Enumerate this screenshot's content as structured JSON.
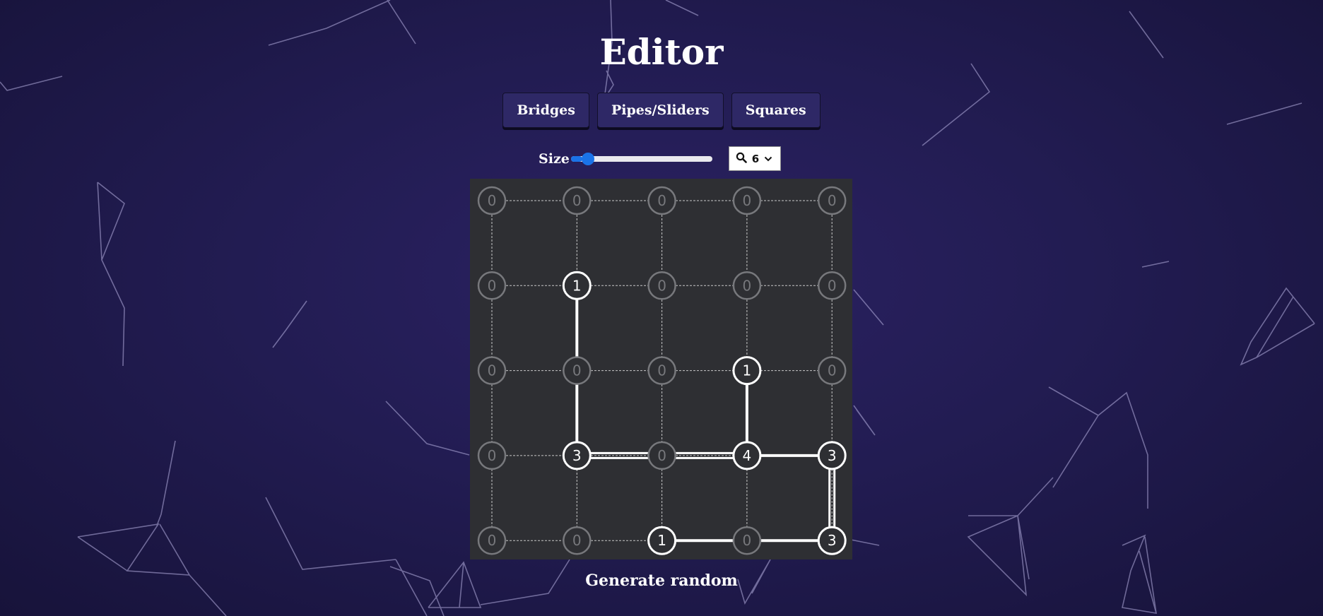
{
  "page": {
    "title": "Editor"
  },
  "modes": [
    {
      "label": "Bridges"
    },
    {
      "label": "Pipes/Sliders"
    },
    {
      "label": "Squares"
    }
  ],
  "size_control": {
    "label": "Size",
    "slider_fraction": 0.08
  },
  "zoom": {
    "icon": "magnifier-icon",
    "value": "6",
    "dropdown_icon": "chevron-down-icon"
  },
  "puzzle": {
    "type": "bridges",
    "rows": 5,
    "cols": 5,
    "clues": [
      [
        "0",
        "0",
        "0",
        "0",
        "0"
      ],
      [
        "0",
        "1",
        "0",
        "0",
        "0"
      ],
      [
        "0",
        "0",
        "0",
        "1",
        "0"
      ],
      [
        "0",
        "3",
        "0",
        "4",
        "3"
      ],
      [
        "0",
        "0",
        "1",
        "0",
        "3"
      ]
    ],
    "bridges": [
      {
        "from": [
          1,
          1
        ],
        "to": [
          3,
          1
        ],
        "count": 1
      },
      {
        "from": [
          2,
          3
        ],
        "to": [
          3,
          3
        ],
        "count": 1
      },
      {
        "from": [
          3,
          1
        ],
        "to": [
          3,
          3
        ],
        "count": 2
      },
      {
        "from": [
          3,
          3
        ],
        "to": [
          3,
          4
        ],
        "count": 1
      },
      {
        "from": [
          3,
          4
        ],
        "to": [
          4,
          4
        ],
        "count": 2
      },
      {
        "from": [
          4,
          2
        ],
        "to": [
          4,
          4
        ],
        "count": 1
      }
    ],
    "colors": {
      "board": "#2e2f33",
      "active_node_fill": "#2e2f33",
      "active_node_stroke": "#ffffff",
      "inactive_node": "#77787c",
      "bridge": "#ffffff",
      "grid": "#c8c8c8"
    }
  },
  "actions": {
    "generate_label": "Generate random"
  },
  "colors": {
    "background": "#221c52",
    "button": "#2e2866",
    "slider_accent": "#1a73e8"
  }
}
